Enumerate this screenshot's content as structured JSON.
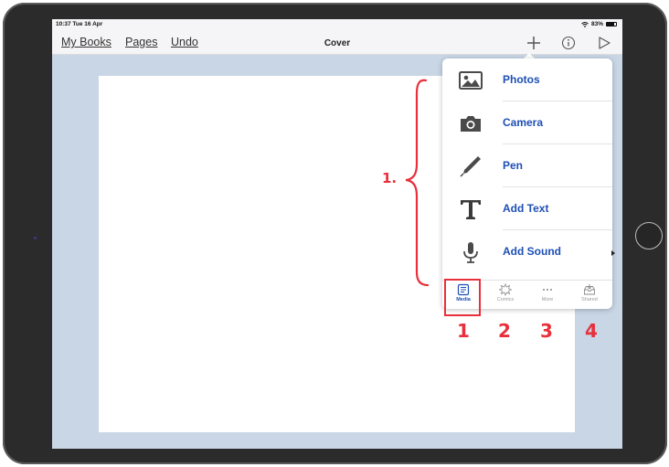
{
  "status_bar": {
    "time": "10:37  Tue 16 Apr",
    "battery_text": "83%",
    "battery_level": 0.83,
    "wifi_icon": "wifi-icon"
  },
  "toolbar": {
    "my_books": "My Books",
    "pages": "Pages",
    "undo": "Undo",
    "title": "Cover",
    "icons": [
      "plus-icon",
      "info-icon",
      "play-icon"
    ]
  },
  "menu": {
    "items": [
      {
        "label": "Photos",
        "icon": "photos-icon"
      },
      {
        "label": "Camera",
        "icon": "camera-icon"
      },
      {
        "label": "Pen",
        "icon": "pen-icon"
      },
      {
        "label": "Add Text",
        "icon": "text-icon"
      },
      {
        "label": "Add Sound",
        "icon": "microphone-icon"
      }
    ]
  },
  "tabs": [
    {
      "label": "Media",
      "icon": "media-icon",
      "active": true
    },
    {
      "label": "Comics",
      "icon": "comics-icon",
      "active": false
    },
    {
      "label": "More",
      "icon": "more-icon",
      "active": false
    },
    {
      "label": "Shared",
      "icon": "shared-icon",
      "active": false
    }
  ],
  "annotations": {
    "bracket_label": "1.",
    "tab_numbers": [
      "1",
      "2",
      "3",
      "4"
    ],
    "color": "#e8303c"
  },
  "colors": {
    "accent": "#1e4fb5",
    "background": "#c8d6e5",
    "annotation": "#e8303c"
  }
}
